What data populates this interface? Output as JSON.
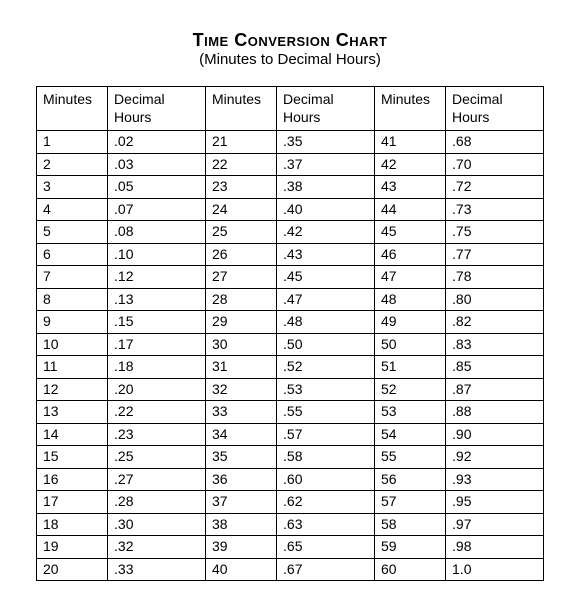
{
  "title": "Time Conversion Chart",
  "subtitle": "(Minutes to Decimal Hours)",
  "headers": {
    "minutes": "Minutes",
    "decimal": "Decimal Hours"
  },
  "chart_data": {
    "type": "table",
    "columns": [
      "Minutes",
      "Decimal Hours"
    ],
    "rows": [
      [
        "1",
        ".02"
      ],
      [
        "2",
        ".03"
      ],
      [
        "3",
        ".05"
      ],
      [
        "4",
        ".07"
      ],
      [
        "5",
        ".08"
      ],
      [
        "6",
        ".10"
      ],
      [
        "7",
        ".12"
      ],
      [
        "8",
        ".13"
      ],
      [
        "9",
        ".15"
      ],
      [
        "10",
        ".17"
      ],
      [
        "11",
        ".18"
      ],
      [
        "12",
        ".20"
      ],
      [
        "13",
        ".22"
      ],
      [
        "14",
        ".23"
      ],
      [
        "15",
        ".25"
      ],
      [
        "16",
        ".27"
      ],
      [
        "17",
        ".28"
      ],
      [
        "18",
        ".30"
      ],
      [
        "19",
        ".32"
      ],
      [
        "20",
        ".33"
      ],
      [
        "21",
        ".35"
      ],
      [
        "22",
        ".37"
      ],
      [
        "23",
        ".38"
      ],
      [
        "24",
        ".40"
      ],
      [
        "25",
        ".42"
      ],
      [
        "26",
        ".43"
      ],
      [
        "27",
        ".45"
      ],
      [
        "28",
        ".47"
      ],
      [
        "29",
        ".48"
      ],
      [
        "30",
        ".50"
      ],
      [
        "31",
        ".52"
      ],
      [
        "32",
        ".53"
      ],
      [
        "33",
        ".55"
      ],
      [
        "34",
        ".57"
      ],
      [
        "35",
        ".58"
      ],
      [
        "36",
        ".60"
      ],
      [
        "37",
        ".62"
      ],
      [
        "38",
        ".63"
      ],
      [
        "39",
        ".65"
      ],
      [
        "40",
        ".67"
      ],
      [
        "41",
        ".68"
      ],
      [
        "42",
        ".70"
      ],
      [
        "43",
        ".72"
      ],
      [
        "44",
        ".73"
      ],
      [
        "45",
        ".75"
      ],
      [
        "46",
        ".77"
      ],
      [
        "47",
        ".78"
      ],
      [
        "48",
        ".80"
      ],
      [
        "49",
        ".82"
      ],
      [
        "50",
        ".83"
      ],
      [
        "51",
        ".85"
      ],
      [
        "52",
        ".87"
      ],
      [
        "53",
        ".88"
      ],
      [
        "54",
        ".90"
      ],
      [
        "55",
        ".92"
      ],
      [
        "56",
        ".93"
      ],
      [
        "57",
        ".95"
      ],
      [
        "58",
        ".97"
      ],
      [
        "59",
        ".98"
      ],
      [
        "60",
        "1.0"
      ]
    ]
  }
}
